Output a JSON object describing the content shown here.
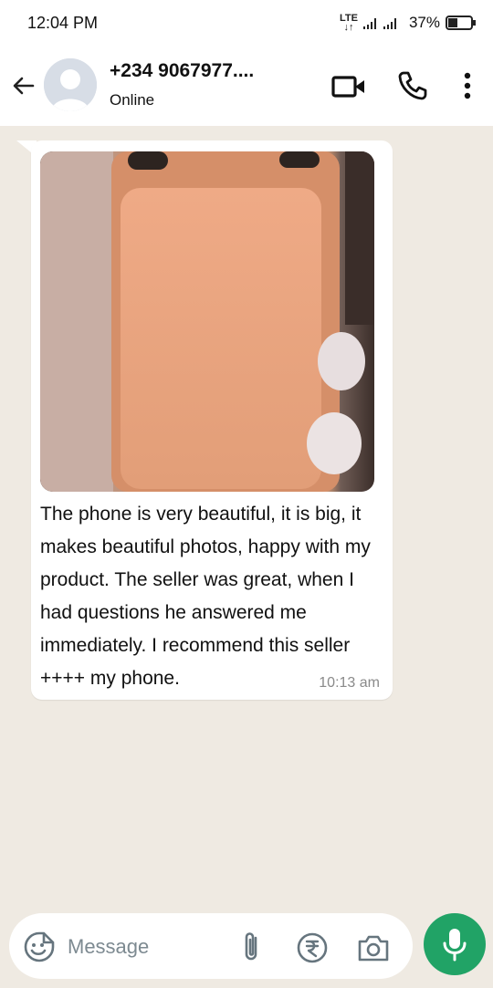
{
  "status_bar": {
    "time": "12:04 PM",
    "network": "LTE",
    "battery": "37%"
  },
  "header": {
    "contact": "+234 9067977....",
    "presence": "Online",
    "icons": [
      "back-arrow-icon",
      "video-call-icon",
      "phone-call-icon",
      "more-options-icon"
    ]
  },
  "message": {
    "text": " The phone is very beautiful, it is big, it makes beautiful photos, happy with my product. The seller was great, when I had questions he answered me immediately. I recommend this seller ++++ my phone.",
    "time": "10:13 am"
  },
  "composer": {
    "placeholder": "Message",
    "icons": [
      "emoji-icon",
      "attachment-icon",
      "payment-icon",
      "camera-icon",
      "microphone-icon"
    ]
  },
  "colors": {
    "chat_background": "#efeae2",
    "bubble": "#ffffff",
    "accent_green": "#21a366"
  }
}
